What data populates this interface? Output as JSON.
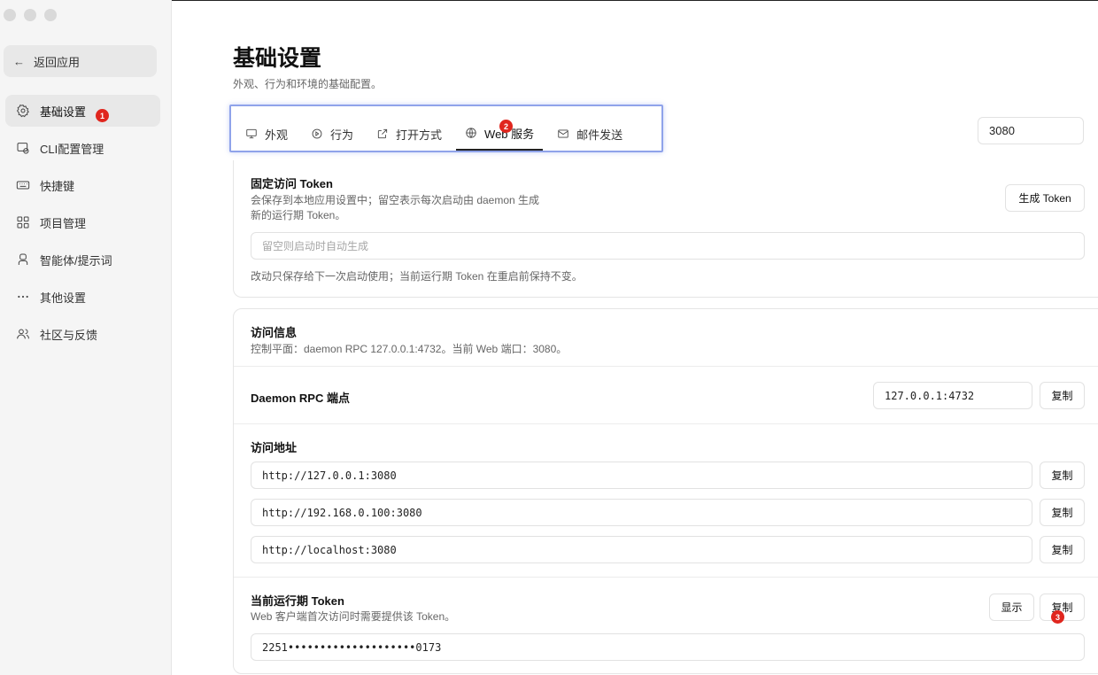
{
  "sidebar": {
    "back_label": "返回应用",
    "items": [
      {
        "label": "基础设置",
        "icon": "gear-icon",
        "active": true
      },
      {
        "label": "CLI配置管理",
        "icon": "cli-config-icon"
      },
      {
        "label": "快捷键",
        "icon": "keyboard-icon"
      },
      {
        "label": "项目管理",
        "icon": "grid-icon"
      },
      {
        "label": "智能体/提示词",
        "icon": "agent-icon"
      },
      {
        "label": "其他设置",
        "icon": "more-icon"
      },
      {
        "label": "社区与反馈",
        "icon": "users-icon"
      }
    ]
  },
  "markers": [
    "1",
    "2",
    "3"
  ],
  "page": {
    "title": "基础设置",
    "subtitle": "外观、行为和环境的基础配置。"
  },
  "tabs": [
    {
      "label": "外观",
      "icon": "monitor-icon"
    },
    {
      "label": "行为",
      "icon": "behavior-icon"
    },
    {
      "label": "打开方式",
      "icon": "external-link-icon"
    },
    {
      "label": "Web 服务",
      "icon": "globe-icon",
      "active": true
    },
    {
      "label": "邮件发送",
      "icon": "mail-icon"
    }
  ],
  "port_value": "3080",
  "fixed_token": {
    "title": "固定访问 Token",
    "desc_line1": "会保存到本地应用设置中；留空表示每次启动由 daemon 生成",
    "desc_line2": "新的运行期 Token。",
    "generate_label": "生成 Token",
    "input_placeholder": "留空则启动时自动生成",
    "note": "改动只保存给下一次启动使用；当前运行期 Token 在重启前保持不变。"
  },
  "access_info": {
    "title": "访问信息",
    "desc": "控制平面：daemon RPC 127.0.0.1:4732。当前 Web 端口：3080。",
    "rpc_label": "Daemon RPC 端点",
    "rpc_value": "127.0.0.1:4732",
    "copy_label": "复制",
    "address_title": "访问地址",
    "addresses": [
      "http://127.0.0.1:3080",
      "http://192.168.0.100:3080",
      "http://localhost:3080"
    ],
    "runtime_token_title": "当前运行期 Token",
    "runtime_token_desc": "Web 客户端首次访问时需要提供该 Token。",
    "show_label": "显示",
    "runtime_token_value": "2251••••••••••••••••••••0173"
  }
}
